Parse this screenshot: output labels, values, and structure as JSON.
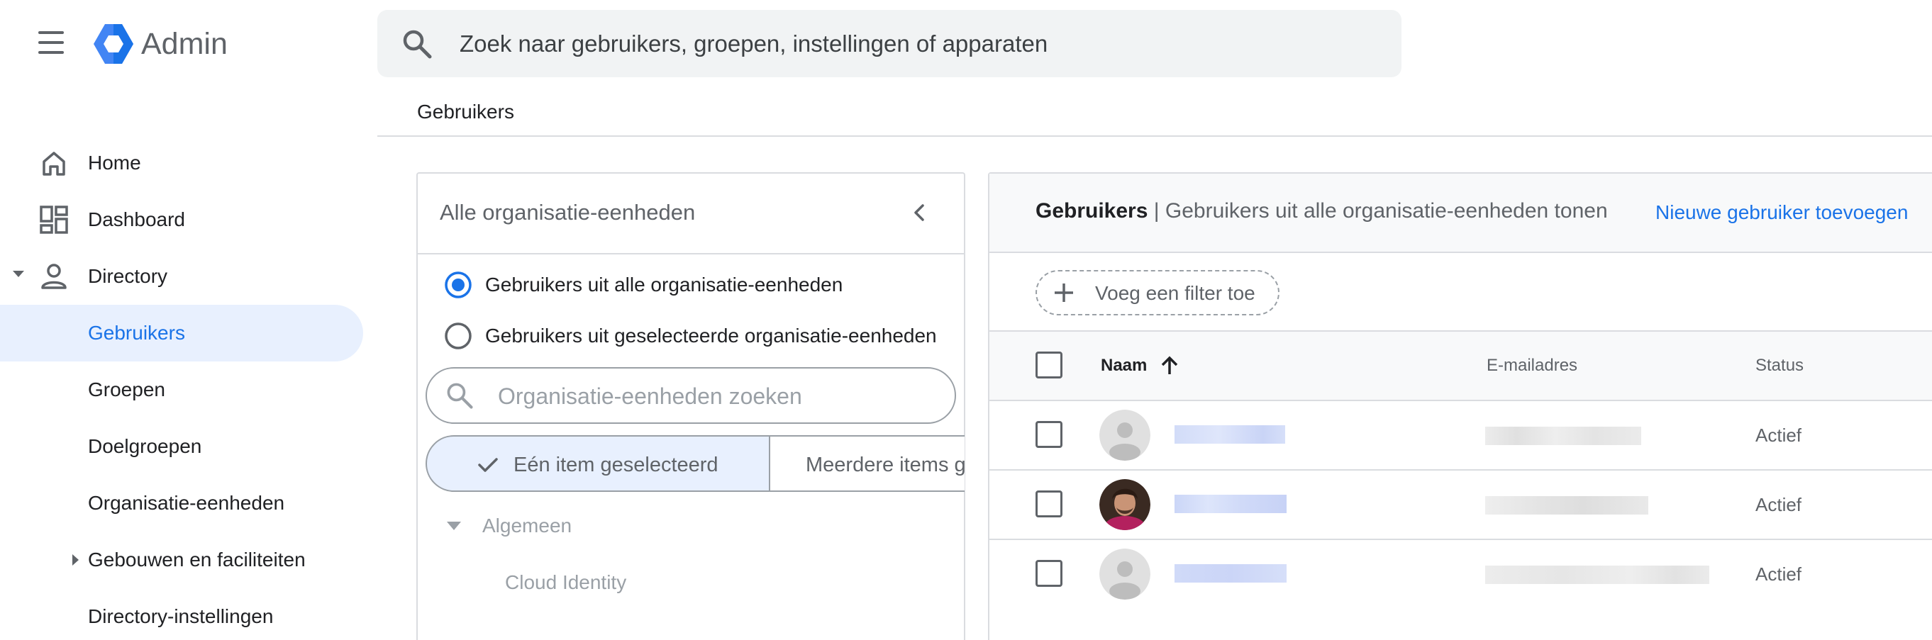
{
  "header": {
    "app_title": "Admin",
    "search_placeholder": "Zoek naar gebruikers, groepen, instellingen of apparaten",
    "logo_colors": [
      "#4285f4",
      "#1a73e8",
      "#ffffff"
    ]
  },
  "breadcrumb": "Gebruikers",
  "sidebar": {
    "items": [
      {
        "label": "Home",
        "icon": "home-icon"
      },
      {
        "label": "Dashboard",
        "icon": "dashboard-icon"
      },
      {
        "label": "Directory",
        "icon": "person-icon",
        "expanded": true
      },
      {
        "label": "Gebruikers",
        "active": true
      },
      {
        "label": "Groepen"
      },
      {
        "label": "Doelgroepen"
      },
      {
        "label": "Organisatie-eenheden"
      },
      {
        "label": "Gebouwen en faciliteiten",
        "collapsed": true
      },
      {
        "label": "Directory-instellingen"
      }
    ]
  },
  "ou_panel": {
    "title": "Alle organisatie-eenheden",
    "radio_all": "Gebruikers uit alle organisatie-eenheden",
    "radio_selected": "Gebruikers uit geselecteerde organisatie-eenheden",
    "radio_checked": "all",
    "search_placeholder": "Organisatie-eenheden zoeken",
    "segment_one": "Eén item geselecteerd",
    "segment_multi": "Meerdere items g",
    "tree_root": "Algemeen",
    "tree_child": "Cloud Identity"
  },
  "users_panel": {
    "title": "Gebruikers",
    "subtitle": " | Gebruikers uit alle organisatie-eenheden tonen",
    "add_user": "Nieuwe gebruiker toevoegen",
    "filter": "Voeg een filter toe",
    "columns": {
      "name": "Naam",
      "email": "E-mailadres",
      "status": "Status"
    },
    "sort": "ascending",
    "rows": [
      {
        "avatar": "default",
        "status": "Actief"
      },
      {
        "avatar": "photo",
        "status": "Actief"
      },
      {
        "avatar": "default",
        "status": "Actief"
      }
    ]
  },
  "colors": {
    "accent": "#1a73e8",
    "active_bg": "#e8f0fe",
    "redacted_name": "#d2dcf8",
    "redacted_email": "#e8e8e8"
  }
}
